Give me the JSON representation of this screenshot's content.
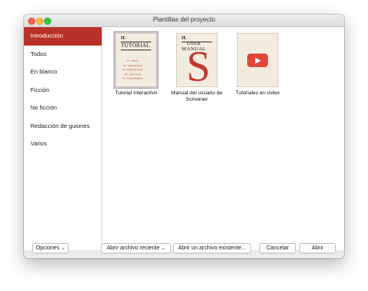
{
  "window": {
    "title": "Plantillas del proyecto"
  },
  "sidebar": {
    "items": [
      {
        "label": "Introducción",
        "active": true
      },
      {
        "label": "Todos"
      },
      {
        "label": "En blanco"
      },
      {
        "label": "Ficción"
      },
      {
        "label": "No ficción"
      },
      {
        "label": "Redacción de guiones"
      },
      {
        "label": "Varios"
      }
    ]
  },
  "templates": [
    {
      "label": "Tutorial interactivo",
      "thumb": {
        "heading": "II.",
        "title": "TUTORIAL",
        "items": [
          {
            "n": "01",
            "text": "Basics"
          },
          {
            "n": "02",
            "text": "Organisation"
          },
          {
            "n": "03",
            "text": "Import/Export"
          },
          {
            "n": "04",
            "text": "Text Tools"
          },
          {
            "n": "05",
            "text": "Customisation"
          }
        ]
      }
    },
    {
      "label": "Manual del usuario de Scrivener",
      "thumb": {
        "heading": "II.",
        "title_line1": "USER",
        "title_line2": "MANUAL",
        "glyph": "S"
      }
    },
    {
      "label": "Tutoriales en vídeo",
      "thumb": {
        "icon": "youtube-play-icon"
      }
    }
  ],
  "bottom": {
    "options_label": "Opciones",
    "recent_label": "Abrir archivo reciente",
    "existing_label": "Abrir un archivo existente...",
    "cancel_label": "Cancelar",
    "open_label": "Abrir"
  },
  "colors": {
    "accent": "#b93229",
    "thumb_bg": "#f2ecdf",
    "youtube": "#e0473b"
  }
}
